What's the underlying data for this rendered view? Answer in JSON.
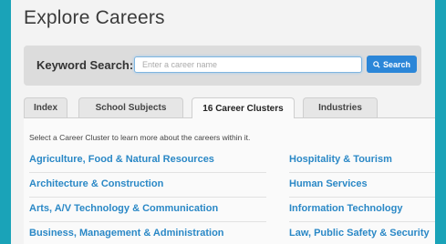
{
  "page": {
    "title": "Explore Careers"
  },
  "search": {
    "label": "Keyword Search:",
    "placeholder": "Enter a career name",
    "button_label": "Search"
  },
  "tabs": [
    {
      "label": "Index",
      "active": false
    },
    {
      "label": "School Subjects",
      "active": false
    },
    {
      "label": "16 Career Clusters",
      "active": true
    },
    {
      "label": "Industries",
      "active": false
    }
  ],
  "clusters": {
    "intro": "Select a Career Cluster to learn more about the careers within it.",
    "left": [
      "Agriculture, Food & Natural Resources",
      "Architecture & Construction",
      "Arts, A/V Technology & Communication",
      "Business, Management & Administration"
    ],
    "right": [
      "Hospitality & Tourism",
      "Human Services",
      "Information Technology",
      "Law, Public Safety & Security"
    ]
  },
  "colors": {
    "frame": "#1aa3b8",
    "link": "#2a88c6",
    "button": "#2b86d8"
  }
}
